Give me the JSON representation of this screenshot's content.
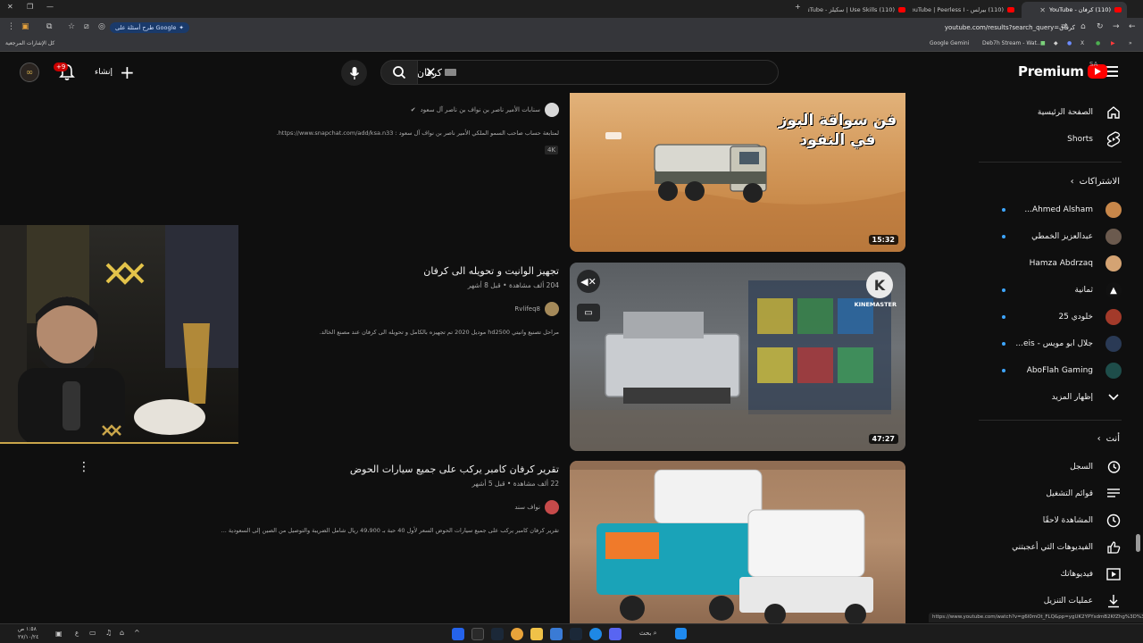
{
  "browser": {
    "tabs": [
      {
        "title": "(110) كرفان - YouTube",
        "active": true
      },
      {
        "title": "(110) بيرلس - YouTube | Peerless I"
      },
      {
        "title": "(110) Use Skills | سكيلز - YouTube"
      }
    ],
    "new_tab": "+",
    "url": "youtube.com/results?search_query=كرفان",
    "gemini_pill": "طرح أسئلة على Google",
    "bookmarks_label": "كل الإشارات المرجعية",
    "bookmarks": [
      "Google Gemini",
      "Deb7h Stream - Wat..."
    ]
  },
  "header": {
    "brand": "Premium",
    "country": "SA",
    "search_value": "كرفان",
    "create_label": "إنشاء",
    "notif_count": "+9"
  },
  "sidebar": {
    "home": "الصفحة الرئيسية",
    "shorts": "Shorts",
    "subscriptions_title": "الاشتراكات",
    "subscriptions": [
      {
        "name": "Ahmed Alsham...",
        "color": "#c8874a"
      },
      {
        "name": "عبدالعزيز الخمطي",
        "color": "#6b5a4e"
      },
      {
        "name": "Hamza Abdrzaq",
        "color": "#d4a373"
      },
      {
        "name": "ثمانية",
        "color": "#111111"
      },
      {
        "name": "خلودي 25",
        "color": "#a33a2a"
      },
      {
        "name": "جلال ابو مويس - eis...",
        "color": "#2a3a55"
      },
      {
        "name": "AboFlah Gaming",
        "color": "#1e4d4a"
      }
    ],
    "show_more": "إظهار المزيد",
    "you_title": "أنت",
    "you_items": [
      "السجل",
      "قوائم التشغيل",
      "المشاهدة لاحقًا",
      "الفيديوهات التي أعجبتني",
      "فيديوهاتك",
      "عمليات التنزيل"
    ]
  },
  "results": [
    {
      "thumb_text": "فن سواقة البوز في النفود",
      "duration": "15:32",
      "channel": "سنابات الأمير ناصر بن نواف بن ناصر آل سعود",
      "description": "لمتابعة حساب صاحب السمو الملكي الأمير ناصر بن نواف آل سعود : https://www.snapchat.com/add/ksa.n33.",
      "badge": "4K"
    },
    {
      "title": "تجهيز الوانيت و تحويله الى كرفان",
      "meta": "204 ألف مشاهدة • قبل 8 أشهر",
      "channel": "Rvlifeq8",
      "description": "مراحل تصنيع وانيتي hd2500 موديل 2020 تم تجهيزه بالكامل و تحويله الى كرفان عند مصنع الخالد.",
      "duration": "47:27",
      "overlay_brand": "KINEMASTER"
    },
    {
      "title": "تقرير كرفان كامبر يركب على جميع سيارات الحوض",
      "meta": "22 ألف مشاهدة • قبل 5 أشهر",
      "channel": "نواف سند",
      "description": "تقرير كرفان كامبر يركب على جميع سيارات الحوض السعر لأول 40 حبة بـ 49،900 ريال شامل الضريبة والتوصيل من الصين إلى السعودية ..."
    }
  ],
  "status_url": "https://www.youtube.com/watch?v=g6l0mOt_FLQ&pp=ygUK2YPYsdmB2KfZhg%3D%3D",
  "taskbar": {
    "search": "بحث",
    "time": "١:٥٨ ص",
    "date": "٢٧/١٠/٢٤",
    "lang": "ع"
  }
}
